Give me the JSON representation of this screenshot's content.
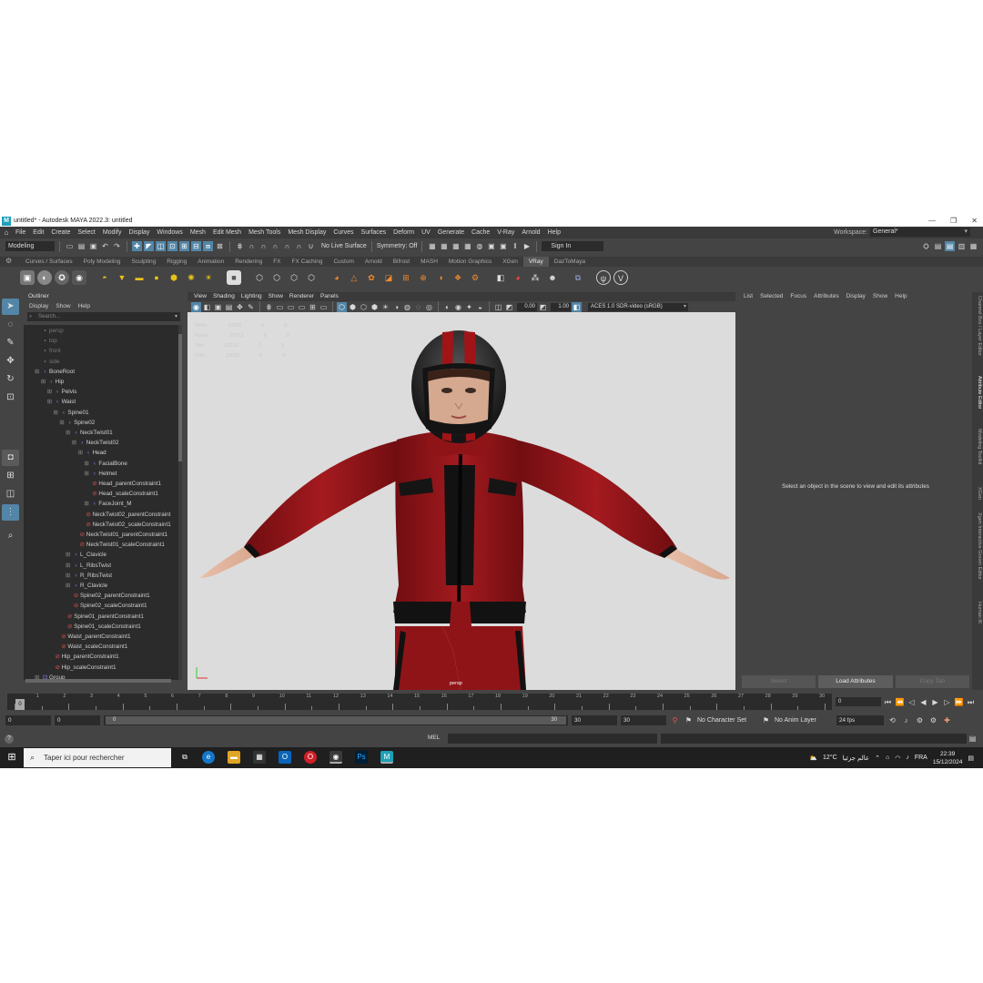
{
  "window": {
    "title": "untitled* - Autodesk MAYA 2022.3: untitled"
  },
  "menubar": [
    "File",
    "Edit",
    "Create",
    "Select",
    "Modify",
    "Display",
    "Windows",
    "Mesh",
    "Edit Mesh",
    "Mesh Tools",
    "Mesh Display",
    "Curves",
    "Surfaces",
    "Deform",
    "UV",
    "Generate",
    "Cache",
    "V-Ray",
    "Arnold",
    "Help"
  ],
  "workspace": {
    "label": "Workspace:",
    "value": "General*"
  },
  "statusline": {
    "mode": "Modeling",
    "live_surface": "No Live Surface",
    "symmetry": "Symmetry: Off",
    "sign_in": "Sign In"
  },
  "shelf_tabs": [
    "Curves / Surfaces",
    "Poly Modeling",
    "Sculpting",
    "Rigging",
    "Animation",
    "Rendering",
    "FX",
    "FX Caching",
    "Custom",
    "Arnold",
    "Bifrost",
    "MASH",
    "Motion Graphics",
    "XGen",
    "VRay",
    "DazToMaya"
  ],
  "shelf_active": "VRay",
  "outliner": {
    "title": "Outliner",
    "menu": [
      "Display",
      "Show",
      "Help"
    ],
    "search_placeholder": "Search...",
    "items": [
      {
        "label": "persp",
        "depth": 0,
        "kind": "camera",
        "expand": false
      },
      {
        "label": "top",
        "depth": 0,
        "kind": "camera",
        "expand": false
      },
      {
        "label": "front",
        "depth": 0,
        "kind": "camera",
        "expand": false
      },
      {
        "label": "side",
        "depth": 0,
        "kind": "camera",
        "expand": false
      },
      {
        "label": "BoneRoot",
        "depth": 0,
        "kind": "joint",
        "expand": true
      },
      {
        "label": "Hip",
        "depth": 1,
        "kind": "joint",
        "expand": true
      },
      {
        "label": "Pelvis",
        "depth": 2,
        "kind": "joint",
        "expand": true
      },
      {
        "label": "Waist",
        "depth": 2,
        "kind": "joint",
        "expand": true
      },
      {
        "label": "Spine01",
        "depth": 3,
        "kind": "joint",
        "expand": true
      },
      {
        "label": "Spine02",
        "depth": 4,
        "kind": "joint",
        "expand": true
      },
      {
        "label": "NeckTwist01",
        "depth": 5,
        "kind": "joint",
        "expand": true
      },
      {
        "label": "NeckTwist02",
        "depth": 6,
        "kind": "joint",
        "expand": true
      },
      {
        "label": "Head",
        "depth": 7,
        "kind": "joint",
        "expand": true
      },
      {
        "label": "FacialBone",
        "depth": 8,
        "kind": "joint",
        "expand": true
      },
      {
        "label": "Helmet",
        "depth": 8,
        "kind": "joint",
        "expand": true
      },
      {
        "label": "Head_parentConstraint1",
        "depth": 8,
        "kind": "constraint",
        "expand": false
      },
      {
        "label": "Head_scaleConstraint1",
        "depth": 8,
        "kind": "constraint",
        "expand": false
      },
      {
        "label": "FaceJoint_M",
        "depth": 8,
        "kind": "joint",
        "expand": true
      },
      {
        "label": "NeckTwist02_parentConstraint",
        "depth": 7,
        "kind": "constraint",
        "expand": false
      },
      {
        "label": "NeckTwist02_scaleConstraint1",
        "depth": 7,
        "kind": "constraint",
        "expand": false
      },
      {
        "label": "NeckTwist01_parentConstraint1",
        "depth": 6,
        "kind": "constraint",
        "expand": false
      },
      {
        "label": "NeckTwist01_scaleConstraint1",
        "depth": 6,
        "kind": "constraint",
        "expand": false
      },
      {
        "label": "L_Clavicle",
        "depth": 5,
        "kind": "joint",
        "expand": true
      },
      {
        "label": "L_RibsTwist",
        "depth": 5,
        "kind": "joint",
        "expand": true
      },
      {
        "label": "R_RibsTwist",
        "depth": 5,
        "kind": "joint",
        "expand": true
      },
      {
        "label": "R_Clavicle",
        "depth": 5,
        "kind": "joint",
        "expand": true
      },
      {
        "label": "Spine02_parentConstraint1",
        "depth": 5,
        "kind": "constraint",
        "expand": false
      },
      {
        "label": "Spine02_scaleConstraint1",
        "depth": 5,
        "kind": "constraint",
        "expand": false
      },
      {
        "label": "Spine01_parentConstraint1",
        "depth": 4,
        "kind": "constraint",
        "expand": false
      },
      {
        "label": "Spine01_scaleConstraint1",
        "depth": 4,
        "kind": "constraint",
        "expand": false
      },
      {
        "label": "Waist_parentConstraint1",
        "depth": 3,
        "kind": "constraint",
        "expand": false
      },
      {
        "label": "Waist_scaleConstraint1",
        "depth": 3,
        "kind": "constraint",
        "expand": false
      },
      {
        "label": "Hip_parentConstraint1",
        "depth": 2,
        "kind": "constraint",
        "expand": false
      },
      {
        "label": "Hip_scaleConstraint1",
        "depth": 2,
        "kind": "constraint",
        "expand": false
      },
      {
        "label": "Group",
        "depth": 0,
        "kind": "group",
        "expand": true
      }
    ]
  },
  "viewport": {
    "menu": [
      "View",
      "Shading",
      "Lighting",
      "Show",
      "Renderer",
      "Panels"
    ],
    "exposure": "0.00",
    "gamma": "1.00",
    "colorspace": "ACES 1.0 SDR-video (sRGB)",
    "camera": "persp"
  },
  "attribute_editor": {
    "menu": [
      "List",
      "Selected",
      "Focus",
      "Attributes",
      "Display",
      "Show",
      "Help"
    ],
    "message": "Select an object in the scene to view and edit its attributes",
    "buttons": [
      "Select",
      "Load Attributes",
      "Copy Tab"
    ]
  },
  "side_tabs": [
    "Channel Box / Layer Editor",
    "Attribute Editor",
    "Modeling Toolkit",
    "XGen",
    "Xgen Interactive Groom Editor",
    "Human IK"
  ],
  "timeline": {
    "ticks": [
      "1",
      "",
      "3",
      "",
      "5",
      "",
      "7",
      "",
      "9",
      "",
      "11",
      "",
      "13",
      "",
      "15",
      "",
      "17",
      "",
      "19",
      "",
      "21",
      "",
      "23",
      "",
      "25",
      "",
      "27",
      "",
      "29",
      ""
    ],
    "labels": [
      "1",
      "2",
      "3",
      "4",
      "5",
      "6",
      "7",
      "8",
      "9",
      "10",
      "11",
      "12",
      "13",
      "14",
      "15",
      "16",
      "17",
      "18",
      "19",
      "20",
      "21",
      "22",
      "23",
      "24",
      "25",
      "26",
      "27",
      "28",
      "29",
      "30"
    ],
    "current": "0",
    "frame_field": "0"
  },
  "range": {
    "start": "0",
    "start2": "0",
    "bar_start": "0",
    "bar_end": "30",
    "end1": "30",
    "end2": "30",
    "char_set": "No Character Set",
    "anim_layer": "No Anim Layer",
    "fps": "24 fps"
  },
  "cmdline": {
    "label": "MEL"
  },
  "taskbar": {
    "search": "Taper ici pour rechercher",
    "weather": "12°C",
    "weather_text": "عالم جزئيا",
    "lang": "FRA",
    "time": "22:39",
    "date": "15/12/2024"
  }
}
